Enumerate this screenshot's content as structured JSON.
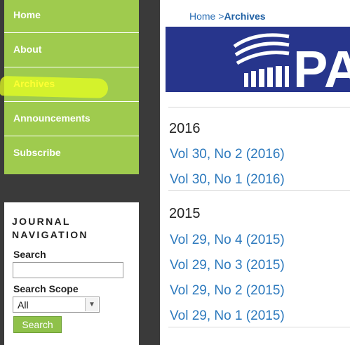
{
  "nav": {
    "items": [
      {
        "label": "Home"
      },
      {
        "label": "About"
      },
      {
        "label": "Archives"
      },
      {
        "label": "Announcements"
      },
      {
        "label": "Subscribe"
      }
    ]
  },
  "journal_nav": {
    "title": "JOURNAL NAVIGATION",
    "search_label": "Search",
    "search_value": "",
    "scope_label": "Search Scope",
    "scope_selected": "All",
    "search_button": "Search"
  },
  "breadcrumb": {
    "home": "Home",
    "separator": ">",
    "current": "Archives"
  },
  "banner": {
    "logo_text": "PA",
    "bg_color": "#27358c"
  },
  "archives": [
    {
      "year": "2016",
      "issues": [
        "Vol 30, No 2 (2016)",
        "Vol 30, No 1 (2016)"
      ]
    },
    {
      "year": "2015",
      "issues": [
        "Vol 29, No 4 (2015)",
        "Vol 29, No 3 (2015)",
        "Vol 29, No 2 (2015)",
        "Vol 29, No 1 (2015)"
      ]
    }
  ],
  "colors": {
    "nav_green": "#9fcb4e",
    "link_blue": "#2c79bd",
    "highlight": "#e6ff22"
  }
}
